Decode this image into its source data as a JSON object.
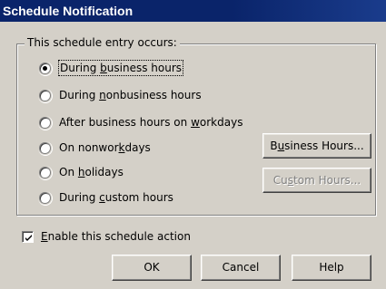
{
  "window": {
    "title": "Schedule Notification"
  },
  "group": {
    "label": "This schedule entry occurs:"
  },
  "options": [
    {
      "pre": "During ",
      "key": "b",
      "post": "usiness hours",
      "selected": true
    },
    {
      "pre": "During ",
      "key": "n",
      "post": "onbusiness hours",
      "selected": false
    },
    {
      "pre": "After business hours on ",
      "key": "w",
      "post": "orkdays",
      "selected": false
    },
    {
      "pre": "On nonwor",
      "key": "k",
      "post": "days",
      "selected": false
    },
    {
      "pre": "On ",
      "key": "h",
      "post": "olidays",
      "selected": false
    },
    {
      "pre": "During ",
      "key": "c",
      "post": "ustom hours",
      "selected": false
    }
  ],
  "buttons": {
    "business_hours": {
      "pre": "B",
      "key": "u",
      "post": "siness Hours..."
    },
    "custom_hours": {
      "pre": "Cu",
      "key": "s",
      "post": "tom Hours..."
    },
    "ok": "OK",
    "cancel": "Cancel",
    "help": "Help"
  },
  "enable_action": {
    "key": "E",
    "post": "nable this schedule action",
    "checked": true
  }
}
